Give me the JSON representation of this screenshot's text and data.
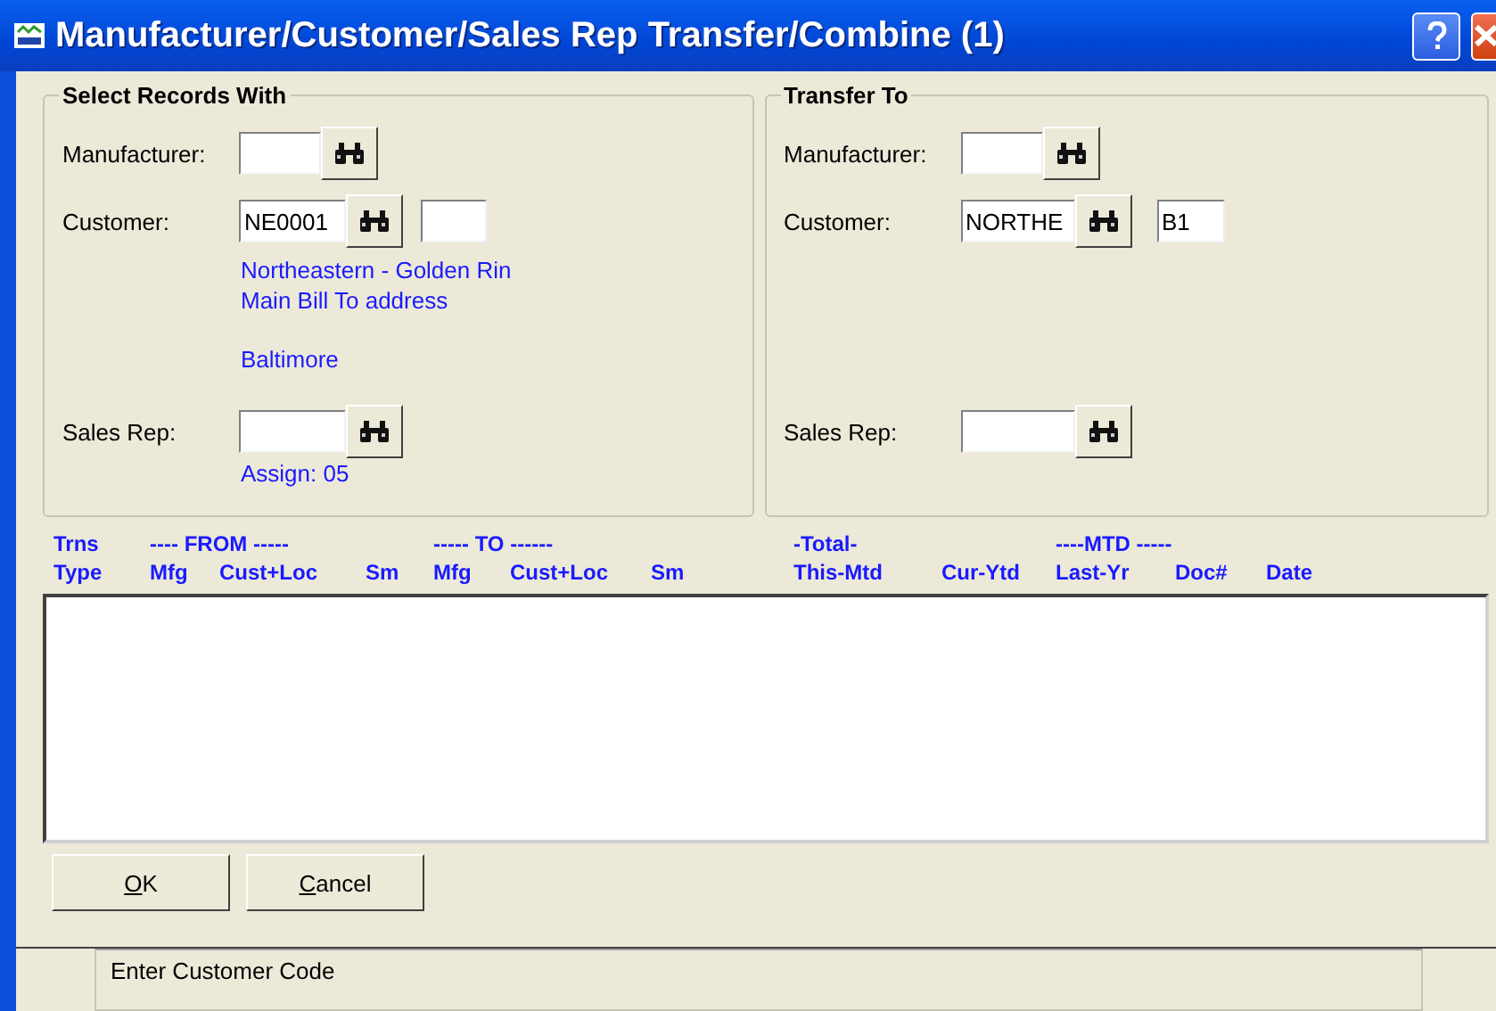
{
  "window": {
    "title": "Manufacturer/Customer/Sales Rep Transfer/Combine (1)"
  },
  "select_records_with": {
    "heading": "Select Records With",
    "manufacturer": {
      "label": "Manufacturer:"
    },
    "customer": {
      "label": "Customer:",
      "value": "NE0001"
    },
    "customer_info": {
      "address_lines": [
        "Northeastern - Golden Rin",
        "Main Bill To address"
      ],
      "city": "Baltimore"
    },
    "sales_rep": {
      "label": "Sales Rep:"
    },
    "sales_rep_info": "Assign: 05"
  },
  "transfer_to": {
    "heading": "Transfer To",
    "manufacturer": {
      "label": "Manufacturer:"
    },
    "customer": {
      "label": "Customer:",
      "value": "NORTHE",
      "location": "B1"
    },
    "sales_rep": {
      "label": "Sales Rep:"
    }
  },
  "list": {
    "group_headers": [
      "Trns",
      "---- FROM -----",
      "----- TO ------",
      "-Total-",
      "----MTD -----"
    ],
    "columns": [
      "Type",
      "Mfg",
      "Cust+Loc",
      "Sm",
      "Mfg",
      "Cust+Loc",
      "Sm",
      "This-Mtd",
      "Cur-Ytd",
      "Last-Yr",
      "Doc#",
      "Date"
    ]
  },
  "buttons": [
    "OK",
    "Cancel"
  ],
  "status_bar": {
    "message": "Enter Customer Code"
  }
}
